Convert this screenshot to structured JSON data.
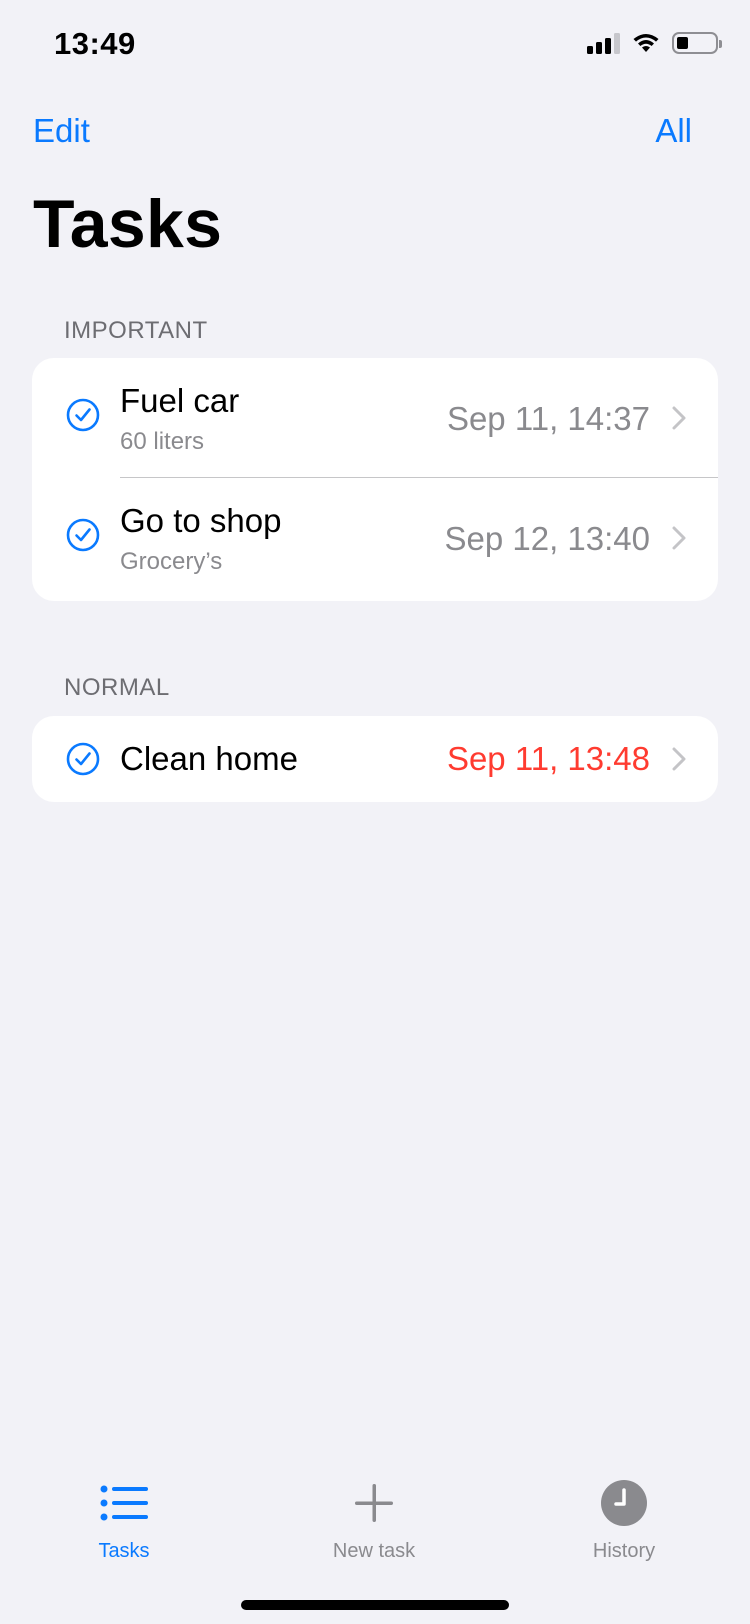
{
  "status_bar": {
    "time": "13:49"
  },
  "nav": {
    "edit_label": "Edit",
    "all_label": "All",
    "title": "Tasks"
  },
  "sections": [
    {
      "header": "IMPORTANT",
      "tasks": [
        {
          "title": "Fuel car",
          "subtitle": "60 liters",
          "date": "Sep 11, 14:37",
          "overdue": false
        },
        {
          "title": "Go to shop",
          "subtitle": "Grocery’s",
          "date": "Sep 12, 13:40",
          "overdue": false
        }
      ]
    },
    {
      "header": "NORMAL",
      "tasks": [
        {
          "title": "Clean home",
          "subtitle": "",
          "date": "Sep 11, 13:48",
          "overdue": true
        }
      ]
    }
  ],
  "tabbar": {
    "tasks_label": "Tasks",
    "new_task_label": "New task",
    "history_label": "History"
  },
  "colors": {
    "accent": "#0a7aff",
    "overdue": "#ff3b30",
    "secondary": "#8a8a8e",
    "background": "#f2f2f7"
  },
  "icons": {
    "check": "checkmark-circle-icon",
    "chevron": "chevron-right-icon",
    "tasks": "list-bullet-icon",
    "new_task": "plus-icon",
    "history": "clock-icon"
  }
}
